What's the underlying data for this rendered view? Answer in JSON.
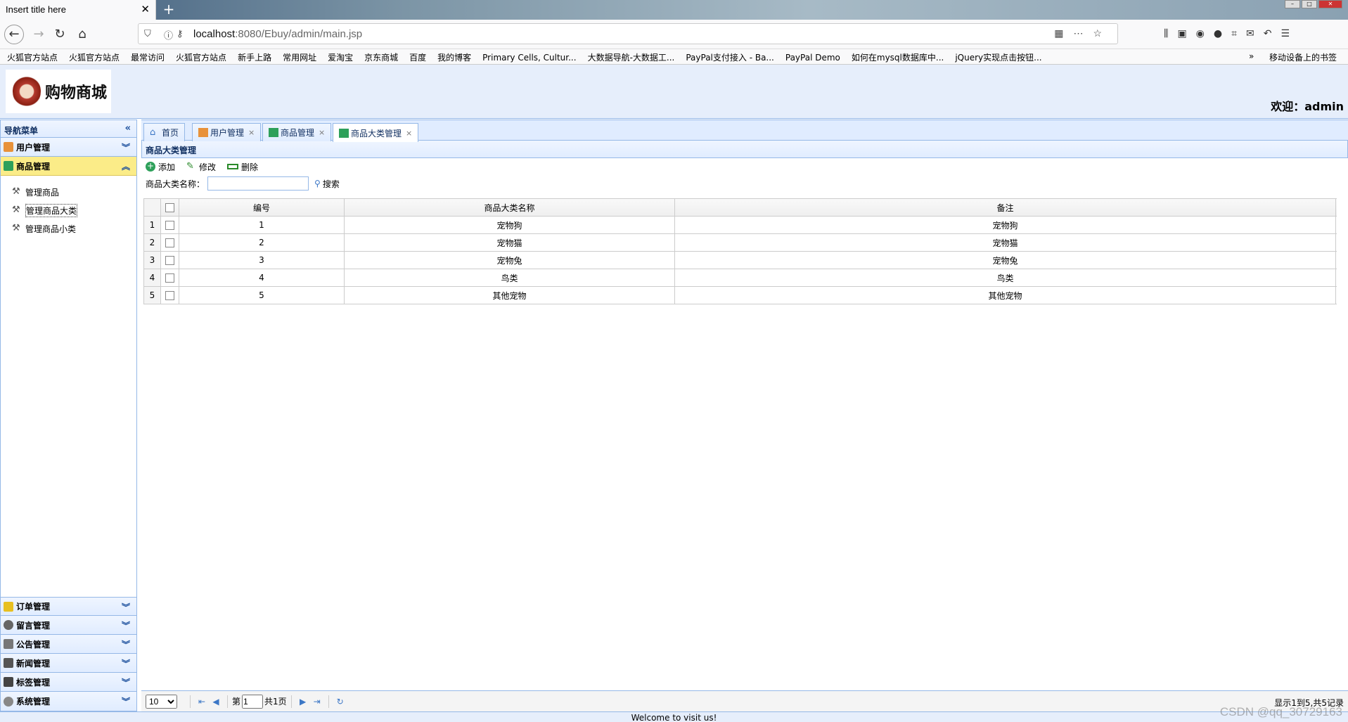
{
  "browser": {
    "tab_title": "Insert title here",
    "tab_close": "✕",
    "new_tab": "+",
    "url_host": "localhost",
    "url_path": ":8080/Ebuy/admin/main.jsp",
    "bookmarks": [
      "火狐官方站点",
      "火狐官方站点",
      "最常访问",
      "火狐官方站点",
      "新手上路",
      "常用网址",
      "爱淘宝",
      "京东商城",
      "百度",
      "我的博客",
      "Primary Cells, Cultur...",
      "大数据导航-大数据工...",
      "PayPal支付接入 - Ba...",
      "PayPal Demo",
      "如何在mysql数据库中...",
      "jQuery实现点击按钮..."
    ],
    "bookmark_overflow": "»",
    "bookmark_last": "移动设备上的书签"
  },
  "header": {
    "logo_text": "购物商城",
    "welcome": "欢迎：admin"
  },
  "sidebar": {
    "title": "导航菜单",
    "collapse": "«",
    "top_items": [
      {
        "label": "用户管理",
        "chev": "︾",
        "color": "#e8923a"
      },
      {
        "label": "商品管理",
        "chev": "︽",
        "color": "#2ea05a"
      }
    ],
    "sub_items": [
      "管理商品",
      "管理商品大类",
      "管理商品小类"
    ],
    "bottom_items": [
      {
        "label": "订单管理",
        "chev": "︾",
        "color": "#e8c020"
      },
      {
        "label": "留言管理",
        "chev": "︾",
        "color": "#666666"
      },
      {
        "label": "公告管理",
        "chev": "︾",
        "color": "#777777"
      },
      {
        "label": "新闻管理",
        "chev": "︾",
        "color": "#555555"
      },
      {
        "label": "标签管理",
        "chev": "︾",
        "color": "#444444"
      },
      {
        "label": "系统管理",
        "chev": "︾",
        "color": "#888888"
      }
    ]
  },
  "tabs": [
    {
      "label": "首页"
    },
    {
      "label": "用户管理",
      "close": "×"
    },
    {
      "label": "商品管理",
      "close": "×"
    },
    {
      "label": "商品大类管理",
      "close": "×"
    }
  ],
  "panel": {
    "title": "商品大类管理",
    "toolbar": {
      "add": "添加",
      "edit": "修改",
      "delete": "删除"
    },
    "search": {
      "label": "商品大类名称：",
      "value": "",
      "button": "搜索"
    }
  },
  "grid": {
    "headers": [
      "编号",
      "商品大类名称",
      "备注"
    ],
    "rows": [
      {
        "num": "1",
        "id": "1",
        "name": "宠物狗",
        "remark": "宠物狗"
      },
      {
        "num": "2",
        "id": "2",
        "name": "宠物猫",
        "remark": "宠物猫"
      },
      {
        "num": "3",
        "id": "3",
        "name": "宠物兔",
        "remark": "宠物兔"
      },
      {
        "num": "4",
        "id": "4",
        "name": "鸟类",
        "remark": "鸟类"
      },
      {
        "num": "5",
        "id": "5",
        "name": "其他宠物",
        "remark": "其他宠物"
      }
    ]
  },
  "pager": {
    "page_size": "10",
    "page_prefix": "第",
    "page_value": "1",
    "page_total": "共1页",
    "info": "显示1到5,共5记录"
  },
  "footer": "Welcome to visit us!",
  "watermark": "CSDN @qq_30729163"
}
